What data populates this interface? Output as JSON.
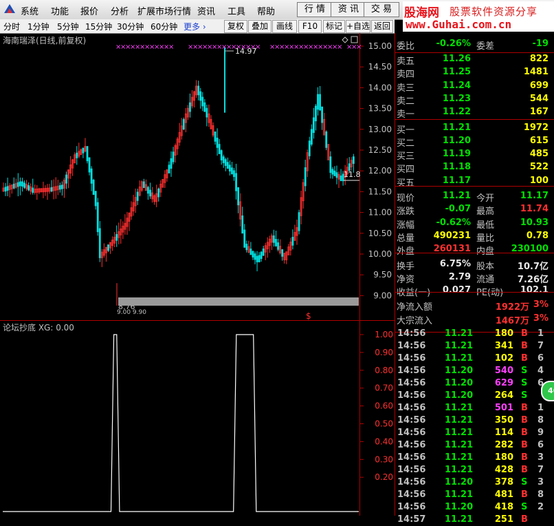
{
  "menu": {
    "items": [
      "系统",
      "功能",
      "报价",
      "分析",
      "扩展市场行情",
      "资讯",
      "工具",
      "帮助"
    ],
    "tabs": [
      "行 情",
      "资 讯",
      "交 易"
    ]
  },
  "brand": {
    "name": "股海网",
    "slogan": "股票软件资源分享",
    "url": "www.Guhai.com.cn"
  },
  "toolbar": {
    "periods": [
      "分时",
      "1分钟",
      "5分钟",
      "15分钟",
      "30分钟",
      "60分钟"
    ],
    "more": "更多 ›",
    "buttons": [
      "复权",
      "叠加",
      "画线",
      "F10",
      "标记",
      "+自选",
      "返回"
    ]
  },
  "chart": {
    "title": "海南瑞泽(日线,前复权)",
    "price_axis": [
      "15.00",
      "14.50",
      "14.00",
      "13.50",
      "13.00",
      "12.50",
      "12.00",
      "11.50",
      "11.00",
      "10.50",
      "10.00",
      "9.50",
      "9.00"
    ],
    "high_label": "14.97",
    "low_label": "8.76",
    "last_label": "11.8",
    "low_sub_label": "9.00 9.90",
    "marker": "$"
  },
  "indicator": {
    "title": "论坛抄底 XG: 0.00",
    "axis": [
      "1.00",
      "0.90",
      "0.80",
      "0.70",
      "0.60",
      "0.50",
      "0.40",
      "0.30",
      "0.20"
    ]
  },
  "chart_data": {
    "type": "line",
    "title": "论坛抄底 XG: 0.00",
    "series": [
      {
        "name": "XG",
        "x": [
          1,
          2,
          3,
          4,
          5,
          6,
          7,
          8,
          9,
          10,
          11,
          12,
          13,
          14,
          15,
          16,
          17,
          18,
          19,
          20,
          21,
          22,
          23,
          24,
          25,
          26,
          27,
          28,
          29,
          30,
          31,
          32,
          33,
          34,
          35,
          36,
          37,
          38,
          39,
          40,
          41,
          42,
          43,
          44,
          45,
          46,
          47,
          48,
          49,
          50,
          51,
          52,
          53,
          54,
          55,
          56,
          57,
          58,
          59,
          60,
          61,
          62,
          63,
          64,
          65,
          66,
          67,
          68,
          69,
          70,
          71,
          72,
          73,
          74,
          75,
          76,
          77,
          78,
          79,
          80,
          81,
          82,
          83,
          84,
          85,
          86,
          87,
          88,
          89,
          90,
          91,
          92,
          93,
          94,
          95,
          96,
          97,
          98,
          99,
          100,
          101,
          102,
          103,
          104,
          105,
          106,
          107,
          108,
          109,
          110,
          111,
          112,
          113,
          114,
          115,
          116,
          117,
          118,
          119,
          120,
          121,
          122,
          123,
          124,
          125,
          126
        ],
        "values": [
          0,
          0,
          0,
          0,
          0,
          0,
          0,
          0,
          0,
          0,
          0,
          0,
          0,
          0,
          0,
          0,
          0,
          0,
          0,
          0,
          0,
          0,
          0,
          0,
          0,
          0,
          0,
          0,
          0,
          0,
          0,
          0,
          0,
          0,
          0,
          0,
          0,
          0,
          0,
          1,
          1,
          0,
          0,
          0,
          0,
          0,
          0,
          0,
          0,
          0,
          0,
          0,
          0,
          0,
          0,
          0,
          0,
          0,
          0,
          0,
          0,
          0,
          0,
          0,
          0,
          0,
          0,
          0,
          0,
          0,
          0,
          0,
          0,
          0,
          0,
          0,
          0,
          0,
          0,
          0,
          0,
          0,
          1,
          1,
          1,
          1,
          1,
          1,
          1,
          0,
          0,
          0,
          0,
          0,
          0,
          0,
          0,
          0,
          0,
          0,
          0,
          0,
          0,
          0,
          0,
          0,
          0,
          0,
          0,
          0,
          0,
          0,
          0,
          0,
          0,
          0,
          0,
          0,
          0,
          0,
          0,
          0,
          0,
          0,
          0,
          0
        ]
      }
    ],
    "ylim": [
      0,
      1
    ],
    "grid": false
  },
  "quote": {
    "weibi": {
      "label": "委比",
      "pct": "-0.26%",
      "label2": "委差",
      "value": "-19"
    },
    "sell": [
      {
        "label": "卖五",
        "price": "11.26",
        "vol": "822"
      },
      {
        "label": "卖四",
        "price": "11.25",
        "vol": "1481"
      },
      {
        "label": "卖三",
        "price": "11.24",
        "vol": "699"
      },
      {
        "label": "卖二",
        "price": "11.23",
        "vol": "544"
      },
      {
        "label": "卖一",
        "price": "11.22",
        "vol": "167"
      }
    ],
    "buy": [
      {
        "label": "买一",
        "price": "11.21",
        "vol": "1972"
      },
      {
        "label": "买二",
        "price": "11.20",
        "vol": "615"
      },
      {
        "label": "买三",
        "price": "11.19",
        "vol": "485"
      },
      {
        "label": "买四",
        "price": "11.18",
        "vol": "522"
      },
      {
        "label": "买五",
        "price": "11.17",
        "vol": "100"
      }
    ],
    "stats": [
      {
        "l1": "现价",
        "v1": "11.21",
        "c1": "g",
        "l2": "今开",
        "v2": "11.17",
        "c2": "g"
      },
      {
        "l1": "涨跌",
        "v1": "-0.07",
        "c1": "g",
        "l2": "最高",
        "v2": "11.74",
        "c2": "r"
      },
      {
        "l1": "涨幅",
        "v1": "-0.62%",
        "c1": "g",
        "l2": "最低",
        "v2": "10.93",
        "c2": "g"
      },
      {
        "l1": "总量",
        "v1": "490231",
        "c1": "y",
        "l2": "量比",
        "v2": "0.78",
        "c2": "y"
      },
      {
        "l1": "外盘",
        "v1": "260131",
        "c1": "r",
        "l2": "内盘",
        "v2": "230100",
        "c2": "g"
      }
    ],
    "stats2": [
      {
        "l1": "换手",
        "v1": "6.75%",
        "l2": "股本",
        "v2": "10.7亿"
      },
      {
        "l1": "净资",
        "v1": "2.79",
        "l2": "流通",
        "v2": "7.26亿"
      },
      {
        "l1": "收益(一)",
        "v1": "0.027",
        "l2": "PE(动)",
        "v2": "102.1"
      }
    ],
    "flows": [
      {
        "label": "净流入额",
        "value": "1922万",
        "pct": "3%"
      },
      {
        "label": "大宗流入",
        "value": "1467万",
        "pct": "3%"
      }
    ],
    "badge": "46",
    "ticks": [
      {
        "t": "14:56",
        "p": "11.21",
        "v": "180",
        "vc": "y",
        "bs": "B",
        "bc": "r",
        "n": "1"
      },
      {
        "t": "14:56",
        "p": "11.21",
        "v": "341",
        "vc": "y",
        "bs": "B",
        "bc": "r",
        "n": "7"
      },
      {
        "t": "14:56",
        "p": "11.21",
        "v": "102",
        "vc": "y",
        "bs": "B",
        "bc": "r",
        "n": "6"
      },
      {
        "t": "14:56",
        "p": "11.20",
        "v": "540",
        "vc": "m",
        "bs": "S",
        "bc": "g",
        "n": "4"
      },
      {
        "t": "14:56",
        "p": "11.20",
        "v": "629",
        "vc": "m",
        "bs": "S",
        "bc": "g",
        "n": "6"
      },
      {
        "t": "14:56",
        "p": "11.20",
        "v": "264",
        "vc": "y",
        "bs": "S",
        "bc": "g",
        "n": ""
      },
      {
        "t": "14:56",
        "p": "11.21",
        "v": "501",
        "vc": "m",
        "bs": "B",
        "bc": "r",
        "n": "1"
      },
      {
        "t": "14:56",
        "p": "11.21",
        "v": "350",
        "vc": "y",
        "bs": "B",
        "bc": "r",
        "n": "8"
      },
      {
        "t": "14:56",
        "p": "11.21",
        "v": "114",
        "vc": "y",
        "bs": "B",
        "bc": "r",
        "n": "9"
      },
      {
        "t": "14:56",
        "p": "11.21",
        "v": "282",
        "vc": "y",
        "bs": "B",
        "bc": "r",
        "n": "6"
      },
      {
        "t": "14:56",
        "p": "11.21",
        "v": "180",
        "vc": "y",
        "bs": "B",
        "bc": "r",
        "n": "3"
      },
      {
        "t": "14:56",
        "p": "11.21",
        "v": "428",
        "vc": "y",
        "bs": "B",
        "bc": "r",
        "n": "7"
      },
      {
        "t": "14:56",
        "p": "11.20",
        "v": "378",
        "vc": "y",
        "bs": "S",
        "bc": "g",
        "n": "3"
      },
      {
        "t": "14:56",
        "p": "11.21",
        "v": "481",
        "vc": "y",
        "bs": "B",
        "bc": "r",
        "n": "8"
      },
      {
        "t": "14:56",
        "p": "11.20",
        "v": "418",
        "vc": "y",
        "bs": "S",
        "bc": "g",
        "n": "2"
      },
      {
        "t": "14:57",
        "p": "11.21",
        "v": "251",
        "vc": "y",
        "bs": "B",
        "bc": "r",
        "n": ""
      }
    ]
  },
  "colors": {
    "up": "#ff3030",
    "down": "#00e0e0",
    "grid": "#b00000",
    "bg": "#000000",
    "accent_pink": "#ff40ff"
  }
}
